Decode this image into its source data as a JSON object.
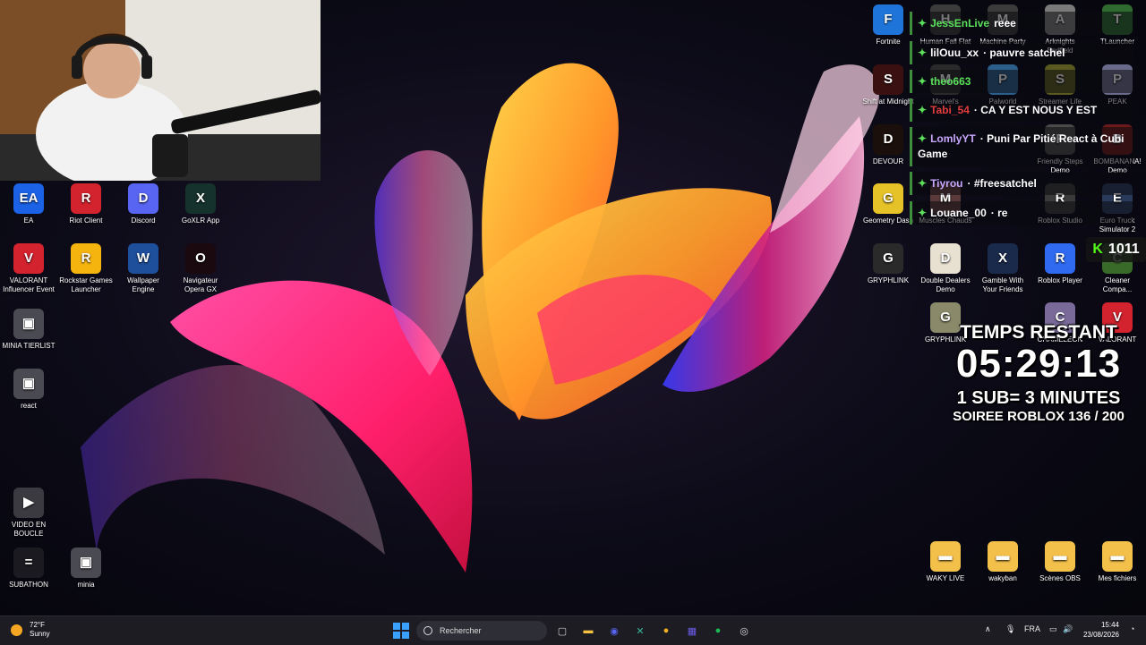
{
  "desktop_left": [
    {
      "name": "ea",
      "label": "EA",
      "glyph": "EA",
      "color": "#1b62e6"
    },
    {
      "name": "riot-client",
      "label": "Riot Client",
      "glyph": "R",
      "color": "#d3232e"
    },
    {
      "name": "discord",
      "label": "Discord",
      "glyph": "D",
      "color": "#5865f2"
    },
    {
      "name": "goxlr",
      "label": "GoXLR App",
      "glyph": "X",
      "color": "#16322c"
    },
    {
      "name": "valorant-influencer",
      "label": "VALORANT Influencer Event",
      "glyph": "V",
      "color": "#d3232e"
    },
    {
      "name": "rockstar",
      "label": "Rockstar Games Launcher",
      "glyph": "R",
      "color": "#f6b40f"
    },
    {
      "name": "wallpaper-engine",
      "label": "Wallpaper Engine",
      "glyph": "W",
      "color": "#1d4f9b"
    },
    {
      "name": "opera-gx",
      "label": "Navigateur Opera GX",
      "glyph": "O",
      "color": "#1a0a10"
    },
    {
      "name": "minia-tierlist",
      "label": "MINIA TIERLIST",
      "glyph": "▣",
      "color": "#4a4a52"
    },
    {
      "name": "react",
      "label": "react",
      "glyph": "▣",
      "color": "#4a4a52"
    },
    {
      "name": "video-en-boucle",
      "label": "VIDEO EN BOUCLE",
      "glyph": "▶",
      "color": "#3a3a40"
    },
    {
      "name": "subathon",
      "label": "SUBATHON",
      "glyph": "=",
      "color": "#1a1a20"
    },
    {
      "name": "minia",
      "label": "minia",
      "glyph": "▣",
      "color": "#4a4a52"
    }
  ],
  "desktop_right": [
    {
      "name": "fortnite",
      "label": "Fortnite",
      "glyph": "F",
      "color": "#1e74d8"
    },
    {
      "name": "human-fall-flat",
      "label": "Human Fall Flat",
      "glyph": "H",
      "color": "#3b3b3b"
    },
    {
      "name": "machine-party",
      "label": "Machine Party",
      "glyph": "M",
      "color": "#3b3b3b"
    },
    {
      "name": "arknights",
      "label": "Arknights Endfield",
      "glyph": "A",
      "color": "#7a7a7a"
    },
    {
      "name": "tlauncher",
      "label": "TLauncher",
      "glyph": "T",
      "color": "#2f6a2f"
    },
    {
      "name": "shift-at-midnight",
      "label": "Shift at Midnight",
      "glyph": "S",
      "color": "#3a1010"
    },
    {
      "name": "marvels",
      "label": "Marvel's",
      "glyph": "M",
      "color": "#2a2a2a"
    },
    {
      "name": "palworld",
      "label": "Palworld",
      "glyph": "P",
      "color": "#2c5e8a"
    },
    {
      "name": "streamer-life",
      "label": "Streamer Life",
      "glyph": "S",
      "color": "#5a5a20"
    },
    {
      "name": "peak",
      "label": "PEAK",
      "glyph": "P",
      "color": "#6a6a8a"
    },
    {
      "name": "devour",
      "label": "DEVOUR",
      "glyph": "D",
      "color": "#1a0f0a"
    },
    {
      "name": "friendly-steps",
      "label": "Friendly Steps Demo",
      "glyph": "F",
      "color": "#4a4a4a"
    },
    {
      "name": "bombanana",
      "label": "BOMBANANA! Demo",
      "glyph": "B",
      "color": "#6a1a1a"
    },
    {
      "name": "geometry-dash",
      "label": "Geometry Dash",
      "glyph": "G",
      "color": "#e6c229"
    },
    {
      "name": "muscles-chauds",
      "label": "Muscles Chauds",
      "glyph": "M",
      "color": "#5a3a3a"
    },
    {
      "name": "roblox-studio",
      "label": "Roblox Studio",
      "glyph": "R",
      "color": "#3a3a3a"
    },
    {
      "name": "euro-truck",
      "label": "Euro Truck Simulator 2",
      "glyph": "E",
      "color": "#2a3a5a"
    },
    {
      "name": "gryphlink",
      "label": "GRYPHLINK",
      "glyph": "G",
      "color": "#2a2a2a"
    },
    {
      "name": "double-dealers",
      "label": "Double Dealers Demo",
      "glyph": "D",
      "color": "#e8e0d0"
    },
    {
      "name": "gamble-with-friends",
      "label": "Gamble With Your Friends",
      "glyph": "X",
      "color": "#1a2a4a"
    },
    {
      "name": "roblox-player",
      "label": "Roblox Player",
      "glyph": "R",
      "color": "#2f6af0"
    },
    {
      "name": "cleaner-compa",
      "label": "Cleaner Compa...",
      "glyph": "C",
      "color": "#3a6a2a"
    },
    {
      "name": "gryphlink-2",
      "label": "GRYPHLINK",
      "glyph": "G",
      "color": "#8a8a6a"
    },
    {
      "name": "chameleon",
      "label": "CHAMELEON",
      "glyph": "C",
      "color": "#7a6a9a"
    },
    {
      "name": "valorant",
      "label": "VALORANT",
      "glyph": "V",
      "color": "#d3232e"
    }
  ],
  "desktop_folders": [
    {
      "name": "waky-live",
      "label": "WAKY LIVE"
    },
    {
      "name": "wakyban",
      "label": "wakyban"
    },
    {
      "name": "scenes-obs",
      "label": "Scènes OBS"
    },
    {
      "name": "mes-fichiers",
      "label": "Mes fichiers"
    }
  ],
  "chat": [
    {
      "user": "JessEnLive",
      "user_color": "#5be05b",
      "msg": "reee"
    },
    {
      "user": "lilOuu_xx",
      "user_color": "#ffffff",
      "msg": "· pauvre satchel"
    },
    {
      "user": "theo663",
      "user_color": "#5be05b",
      "msg": ""
    },
    {
      "user": "Tabi_54",
      "user_color": "#e23b3b",
      "msg": "· CA Y EST NOUS Y EST"
    },
    {
      "user": "LomlyYT",
      "user_color": "#c9a7ff",
      "msg": "· Puni Par Pitié React à Cubi Game"
    },
    {
      "user": "Tiyrou",
      "user_color": "#c9a7ff",
      "msg": "· #freesatchel"
    },
    {
      "user": "Louane_00",
      "user_color": "#ffffff",
      "msg": "· re"
    }
  ],
  "sub_counter": {
    "badge": "K",
    "value": "1011"
  },
  "timer": {
    "title": "TEMPS RESTANT",
    "time": "05:29:13",
    "rule": "1 SUB= 3 MINUTES",
    "goal": "SOIREE ROBLOX 136 / 200"
  },
  "taskbar": {
    "weather_temp": "72°F",
    "weather_cond": "Sunny",
    "search_placeholder": "Rechercher",
    "lang": "FRA",
    "time": "15:44",
    "date": "23/08/2026",
    "apps": [
      {
        "name": "task-view",
        "glyph": "▢",
        "color": "#cfcfcf"
      },
      {
        "name": "file-explorer",
        "glyph": "▬",
        "color": "#f5c242"
      },
      {
        "name": "discord",
        "glyph": "◉",
        "color": "#5865f2"
      },
      {
        "name": "goxlr",
        "glyph": "✕",
        "color": "#37b89a"
      },
      {
        "name": "chrome",
        "glyph": "●",
        "color": "#f2b01e"
      },
      {
        "name": "app-grid",
        "glyph": "▦",
        "color": "#6c5ce7"
      },
      {
        "name": "spotify",
        "glyph": "●",
        "color": "#1db954"
      },
      {
        "name": "obs",
        "glyph": "◎",
        "color": "#dcdcdc"
      }
    ]
  }
}
